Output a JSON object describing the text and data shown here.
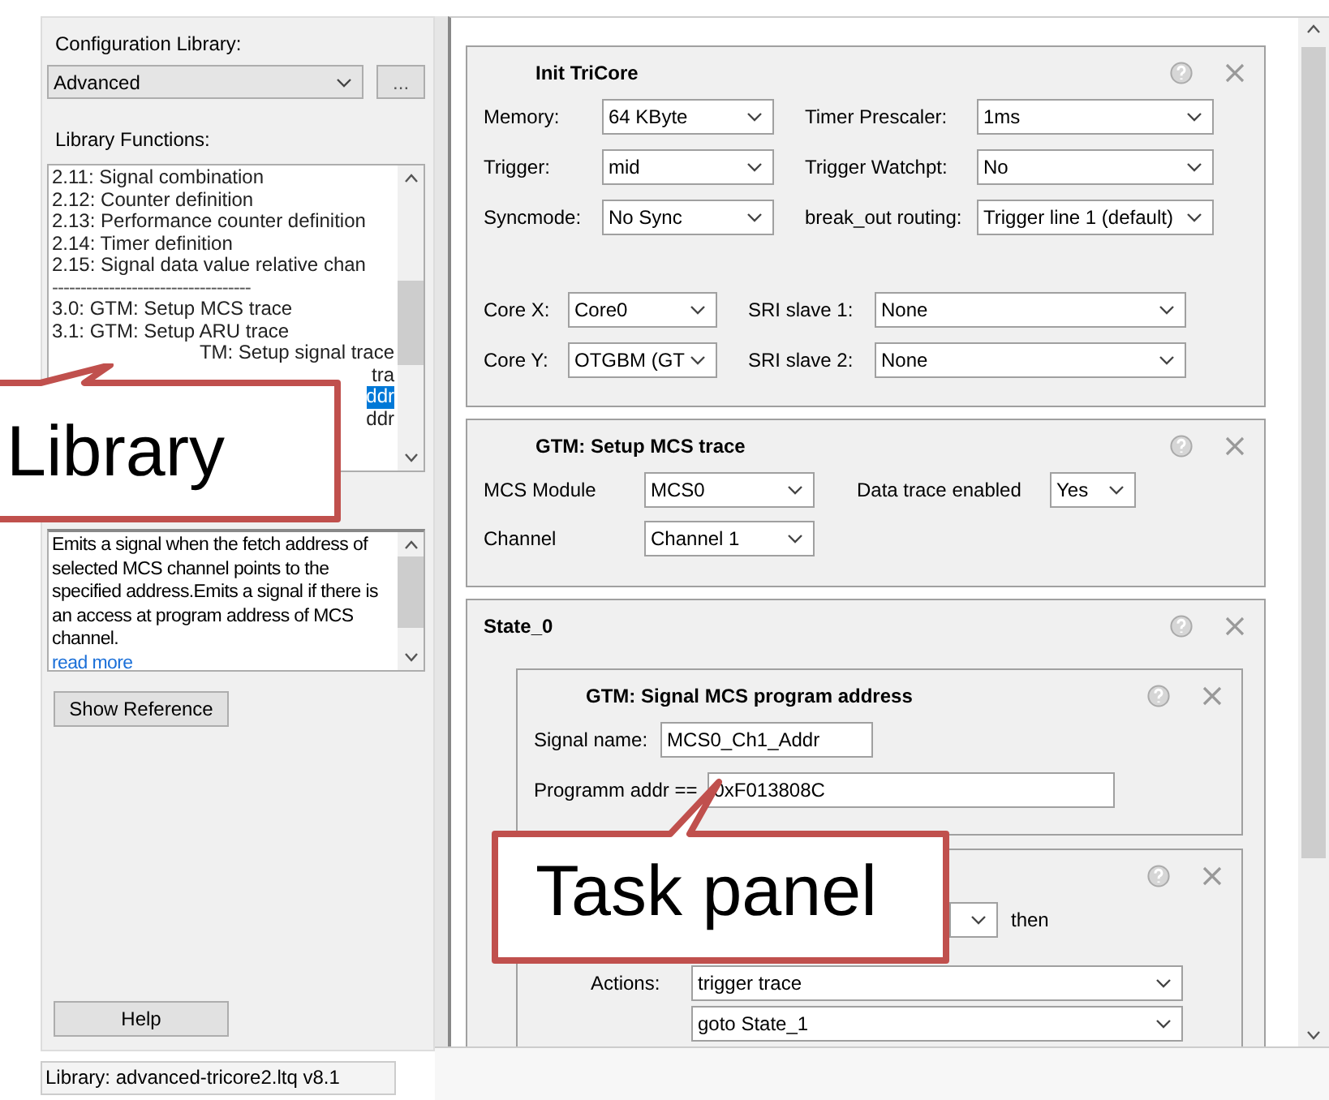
{
  "sidebar": {
    "config_label": "Configuration Library:",
    "config_value": "Advanced",
    "browse_button": "...",
    "functions_label": "Library Functions:",
    "functions": [
      {
        "text": "2.11: Signal combination",
        "kind": "item",
        "selected": false
      },
      {
        "text": "2.12: Counter definition",
        "kind": "item",
        "selected": false
      },
      {
        "text": "2.13: Performance counter definition",
        "kind": "item",
        "selected": false
      },
      {
        "text": "2.14: Timer definition",
        "kind": "item",
        "selected": false
      },
      {
        "text": "2.15: Signal data value relative chan",
        "kind": "item",
        "selected": false
      },
      {
        "text": "-----------------------------------",
        "kind": "separator",
        "selected": false
      },
      {
        "text": "3.0: GTM: Setup MCS trace",
        "kind": "item",
        "selected": false
      },
      {
        "text": "3.1: GTM: Setup ARU trace",
        "kind": "item",
        "selected": false
      },
      {
        "text": "TM: Setup signal trace",
        "kind": "fragment",
        "selected": false
      },
      {
        "text": "tra",
        "kind": "fragment",
        "selected": false
      },
      {
        "text": "ddr",
        "kind": "fragment",
        "selected": true
      },
      {
        "text": "ddr",
        "kind": "fragment",
        "selected": false
      }
    ],
    "description": "Emits a signal when the fetch address of selected MCS channel points to the specified address.Emits a signal if there is an access at program address of MCS channel.",
    "read_more": "read more",
    "show_reference": "Show Reference",
    "help": "Help"
  },
  "cards": [
    {
      "kind": "init",
      "title": "Init  TriCore",
      "sections": [
        [
          {
            "label": "Memory:",
            "value": "64 KByte",
            "kind": "select"
          },
          {
            "label": "Timer Prescaler:",
            "value": "1ms",
            "kind": "select"
          },
          {
            "label": "Trigger:",
            "value": "mid",
            "kind": "select"
          },
          {
            "label": "Trigger Watchpt:",
            "value": "No",
            "kind": "select"
          },
          {
            "label": "Syncmode:",
            "value": "No Sync",
            "kind": "select"
          },
          {
            "label": "break_out routing:",
            "value": "Trigger line 1 (default)",
            "kind": "select"
          }
        ],
        [
          {
            "label": "Core X:",
            "value": "Core0",
            "kind": "select"
          },
          {
            "label": "SRI slave 1:",
            "value": "None",
            "kind": "select"
          },
          {
            "label": "Core Y:",
            "value": "OTGBM (GT",
            "kind": "select"
          },
          {
            "label": "SRI slave 2:",
            "value": "None",
            "kind": "select"
          }
        ]
      ]
    },
    {
      "kind": "mcs",
      "title": "GTM: Setup MCS trace",
      "sections": [
        [
          {
            "label": "MCS Module",
            "value": "MCS0",
            "kind": "select"
          },
          {
            "label": "Data trace enabled",
            "value": "Yes",
            "kind": "select"
          },
          {
            "label": "Channel",
            "value": "Channel 1",
            "kind": "select"
          }
        ]
      ]
    },
    {
      "kind": "state",
      "title": "State_0",
      "children": [
        {
          "kind": "signal",
          "title": "GTM: Signal MCS program address",
          "sections": [
            [
              {
                "label": "Signal name:",
                "value": "MCS0_Ch1_Addr",
                "kind": "text"
              },
              {
                "label": "Programm addr ==",
                "value": "0xF013808C",
                "kind": "text"
              }
            ]
          ]
        },
        {
          "kind": "condition",
          "then": "then",
          "actions_label": "Actions:",
          "actions": [
            "trigger trace",
            "goto State_1"
          ]
        }
      ]
    }
  ],
  "status_bar": "Library: advanced-tricore2.ltq v8.1",
  "callouts": [
    {
      "text": "Library"
    },
    {
      "text": "Task panel"
    }
  ]
}
